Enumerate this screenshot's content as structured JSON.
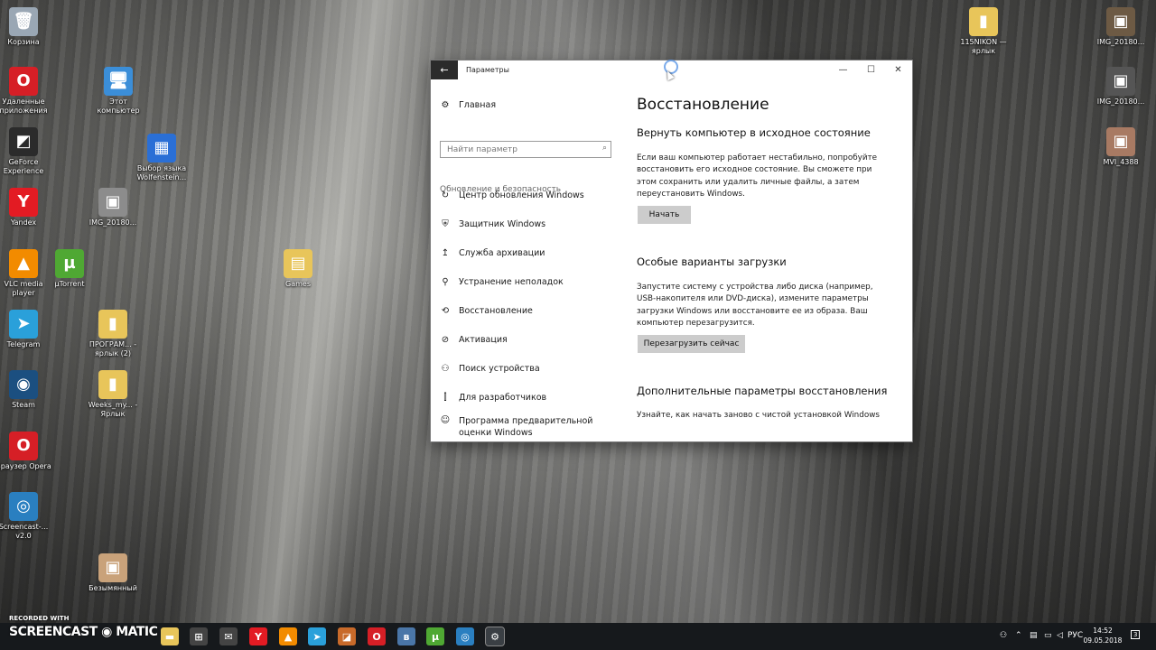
{
  "desktop": {
    "icons": [
      {
        "label": "Корзина",
        "glyph": "🗑",
        "color": "#9aa7b4"
      },
      {
        "label": "Удаленные приложения",
        "glyph": "O",
        "color": "#d61f26"
      },
      {
        "label": "Этот компьютер",
        "glyph": "🖥",
        "color": "#3b8ed8"
      },
      {
        "label": "GeForce Experience",
        "glyph": "◩",
        "color": "#2b2b2b"
      },
      {
        "label": "Выбор языка Wolfenstein...",
        "glyph": "▦",
        "color": "#2a6fd6"
      },
      {
        "label": "Yandex",
        "glyph": "Y",
        "color": "#e31b23"
      },
      {
        "label": "IMG_20180...",
        "glyph": "▣",
        "color": "#8c8c8c"
      },
      {
        "label": "VLC media player",
        "glyph": "▲",
        "color": "#f28b00"
      },
      {
        "label": "µTorrent",
        "glyph": "µ",
        "color": "#4fa833"
      },
      {
        "label": "Games",
        "glyph": "▤",
        "color": "#e8c55a"
      },
      {
        "label": "Telegram",
        "glyph": "➤",
        "color": "#2aa0da"
      },
      {
        "label": "ПРОГРАМ... - ярлык (2)",
        "glyph": "▮",
        "color": "#e8c55a"
      },
      {
        "label": "Steam",
        "glyph": "◉",
        "color": "#1b4f80"
      },
      {
        "label": "Weeks_my... - Ярлык",
        "glyph": "▮",
        "color": "#e8c55a"
      },
      {
        "label": "Браузер Opera",
        "glyph": "O",
        "color": "#d61f26"
      },
      {
        "label": "Screencast-... v2.0",
        "glyph": "◎",
        "color": "#2a7fc0"
      },
      {
        "label": "Безымянный",
        "glyph": "▣",
        "color": "#c9a27a"
      },
      {
        "label": "115NIKON — ярлык",
        "glyph": "▮",
        "color": "#e8c55a"
      },
      {
        "label": "IMG_20180...",
        "glyph": "▣",
        "color": "#6d5a44"
      },
      {
        "label": "IMG_20180...",
        "glyph": "▣",
        "color": "#555555"
      },
      {
        "label": "MVI_4388",
        "glyph": "▣",
        "color": "#a87a63"
      }
    ],
    "watermark_top": "RECORDED WITH",
    "watermark_brand": "SCREENCAST ◉ MATIC"
  },
  "window": {
    "title": "Параметры",
    "back_glyph": "←",
    "minimize_glyph": "—",
    "maximize_glyph": "☐",
    "close_glyph": "✕"
  },
  "nav": {
    "home_label": "Главная",
    "home_icon": "⚙",
    "search_placeholder": "Найти параметр",
    "search_icon": "⌕",
    "section": "Обновление и безопасность",
    "items": [
      {
        "icon": "↻",
        "label": "Центр обновления Windows"
      },
      {
        "icon": "⛨",
        "label": "Защитник Windows"
      },
      {
        "icon": "↥",
        "label": "Служба архивации"
      },
      {
        "icon": "⚲",
        "label": "Устранение неполадок"
      },
      {
        "icon": "⟲",
        "label": "Восстановление"
      },
      {
        "icon": "⊘",
        "label": "Активация"
      },
      {
        "icon": "⚇",
        "label": "Поиск устройства"
      },
      {
        "icon": "⫿",
        "label": "Для разработчиков"
      },
      {
        "icon": "☺",
        "label": "Программа предварительной оценки Windows"
      }
    ]
  },
  "content": {
    "title": "Восстановление",
    "reset": {
      "heading": "Вернуть компьютер в исходное состояние",
      "text": "Если ваш компьютер работает нестабильно, попробуйте восстановить его исходное состояние. Вы сможете при этом сохранить или удалить личные файлы, а затем переустановить Windows.",
      "button": "Начать"
    },
    "advanced_boot": {
      "heading": "Особые варианты загрузки",
      "text": "Запустите систему с устройства либо диска (например, USB-накопителя или DVD-диска), измените параметры загрузки Windows или восстановите ее из образа. Ваш компьютер перезагрузится.",
      "button": "Перезагрузить сейчас"
    },
    "more": {
      "heading": "Дополнительные параметры восстановления",
      "text": "Узнайте, как начать заново с чистой установкой Windows"
    }
  },
  "taskbar": {
    "apps": [
      {
        "name": "file-explorer",
        "glyph": "▬",
        "color": "#e8c55a"
      },
      {
        "name": "store",
        "glyph": "⊞",
        "color": "#444444"
      },
      {
        "name": "mail",
        "glyph": "✉",
        "color": "#444444"
      },
      {
        "name": "yandex",
        "glyph": "Y",
        "color": "#e31b23"
      },
      {
        "name": "vlc",
        "glyph": "▲",
        "color": "#f28b00"
      },
      {
        "name": "telegram",
        "glyph": "➤",
        "color": "#2aa0da"
      },
      {
        "name": "app-orange",
        "glyph": "◪",
        "color": "#c86a2a"
      },
      {
        "name": "opera",
        "glyph": "O",
        "color": "#d61f26"
      },
      {
        "name": "vk",
        "glyph": "в",
        "color": "#4a76a8"
      },
      {
        "name": "utorrent",
        "glyph": "µ",
        "color": "#4fa833"
      },
      {
        "name": "screencast",
        "glyph": "◎",
        "color": "#2a7fc0"
      },
      {
        "name": "settings",
        "glyph": "⚙",
        "color": "#333333"
      }
    ],
    "language": "РУС",
    "time": "14:52",
    "date": "09.05.2018",
    "notifications": "3"
  }
}
